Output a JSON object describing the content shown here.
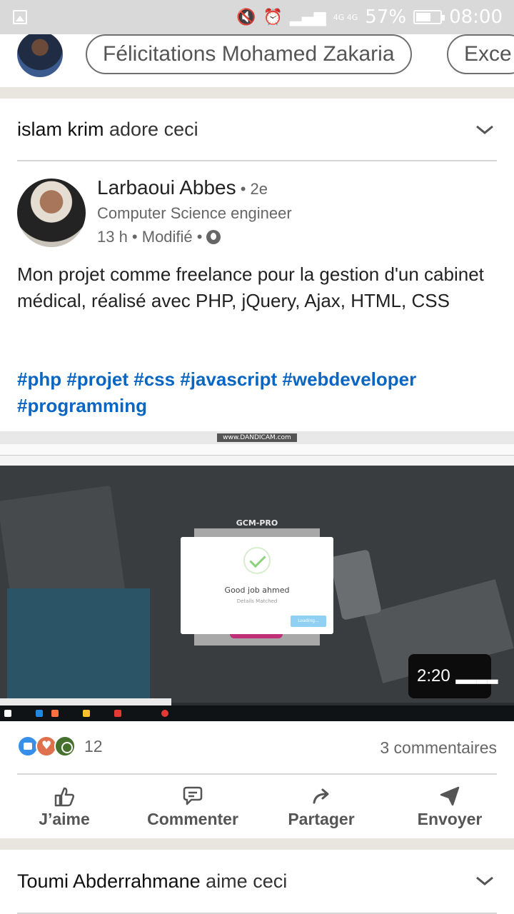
{
  "status_bar": {
    "battery": "57%",
    "time": "08:00",
    "network": "4G 4G"
  },
  "top_pills": [
    "Félicitations Mohamed Zakaria",
    "Exce"
  ],
  "feed_item": {
    "actor": "islam krim",
    "action": "adore ceci"
  },
  "post": {
    "author_name": "Larbaoui Abbes",
    "degree": " • 2e",
    "author_title": "Computer Science engineer",
    "meta": "13 h • Modifié •",
    "text": "Mon projet comme freelance pour la gestion d'un cabinet médical, réalisé avec PHP, jQuery, Ajax, HTML, CSS",
    "hashtags": "#php #projet #css #javascript #webdeveloper #programming"
  },
  "video": {
    "watermark": "www.DANDICAM.com",
    "app_name": "GCM-PRO",
    "modal_title": "Good job ahmed",
    "modal_subtitle": "Details Matched",
    "modal_button": "Loading...",
    "duration": "2:20"
  },
  "social": {
    "reaction_count": "12",
    "comments": "3 commentaires"
  },
  "actions": {
    "like": "J’aime",
    "comment": "Commenter",
    "share": "Partager",
    "send": "Envoyer"
  },
  "next_feed_item": {
    "actor": "Toumi Abderrahmane",
    "action": "aime ceci"
  },
  "colors": {
    "hashtag": "#0a66c2",
    "separator": "#e9e6df",
    "status_bar": "#d9d9d9"
  }
}
